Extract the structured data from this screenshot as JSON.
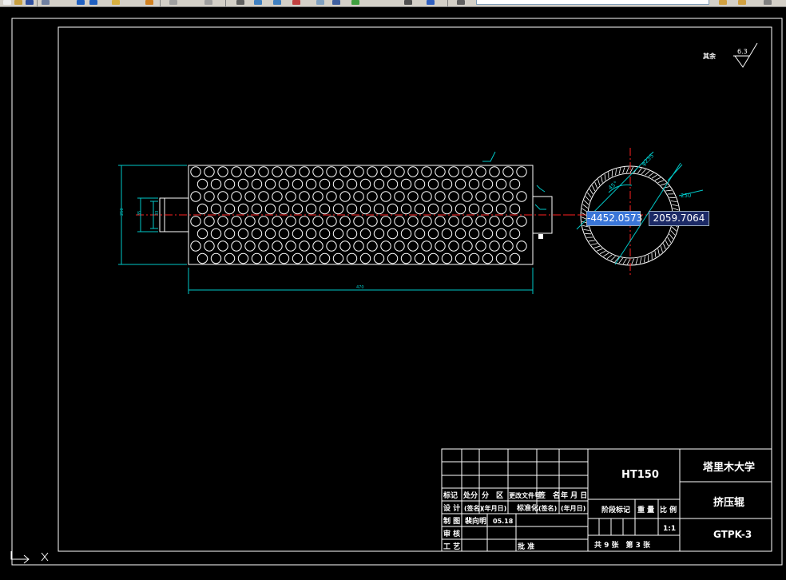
{
  "toolbar": {
    "icons": [
      "new-icon",
      "open-icon",
      "save-icon",
      "plot-icon",
      "undo-icon",
      "redo-icon",
      "pan-icon",
      "zoom-icon",
      "zoom-window-icon",
      "zoom-previous-icon",
      "text-style-icon",
      "properties-icon",
      "design-center-icon",
      "tool-palette-icon",
      "calculator-icon",
      "layer-properties-icon",
      "layer-state-icon"
    ],
    "layer_value": "",
    "colors": {
      "bg": "#d4d0c8"
    }
  },
  "drawing": {
    "colors": {
      "outline": "#ffffff",
      "dimension": "#00c8c8",
      "center": "#ff2020",
      "background": "#000000"
    },
    "dims": {
      "length": "470",
      "diameter": "250",
      "shaft_a": "35",
      "shaft_b": "33",
      "angle": "45°",
      "thread": "φ235"
    },
    "surface_finish": {
      "label": "其余",
      "value": "6.3"
    },
    "crosshair_x": "-4452.0573",
    "crosshair_y": "2059.7064"
  },
  "title_block": {
    "material": "HT150",
    "school": "塔里木大学",
    "part_name": "挤压辊",
    "drawing_no": "GTPK-3",
    "row_head": [
      "标记",
      "处分",
      "分　区",
      "更改文件号",
      "签　名",
      "年 月 日"
    ],
    "row_design": [
      "设 计",
      "(签名)",
      "(年月日)",
      "标准化",
      "(签名)",
      "(年月日)"
    ],
    "row_draw": [
      "制 图",
      "裴向明",
      "05.18"
    ],
    "row_review": "审 核",
    "row_craft": "工 艺",
    "approve": "批 准",
    "stage_label": "阶段标记",
    "weight_label": "重 量",
    "scale_label": "比 例",
    "scale": "1:1",
    "sheets": "共 9 张　第 3 张"
  },
  "command_line": ""
}
